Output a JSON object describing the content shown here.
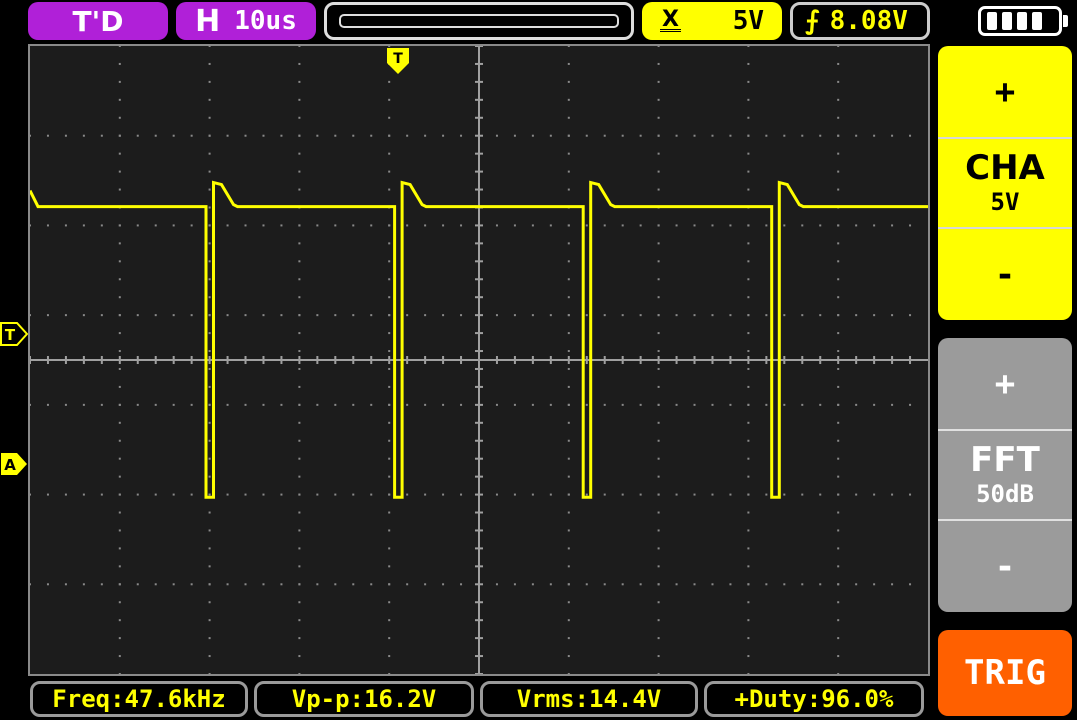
{
  "top_bar": {
    "mode_label": "T'D",
    "timebase_letter": "H",
    "timebase_value": "10us",
    "channel_scale": "5V",
    "channel_icon": "channel-coupling-icon",
    "trigger_level": "8.08V",
    "trigger_icon": "rising-edge-icon",
    "battery_icon": "battery-full-icon"
  },
  "markers": {
    "trigger_time_marker": "T",
    "trigger_level_marker": "T",
    "channel_marker": "A"
  },
  "right_panel": {
    "channel": {
      "plus": "+",
      "name": "CHA",
      "scale": "5V",
      "minus": "-"
    },
    "fft": {
      "plus": "+",
      "name": "FFT",
      "scale": "50dB",
      "minus": "-"
    },
    "trig_button": "TRIG"
  },
  "measurements": {
    "freq": "Freq:47.6kHz",
    "vpp": "Vp-p:16.2V",
    "vrms": "Vrms:14.4V",
    "duty": "+Duty:96.0%"
  },
  "colors": {
    "trace": "#ffff00",
    "mode_accent": "#b020d8",
    "channel_accent": "#ffff00",
    "fft_accent": "#9b9b9b",
    "trig_accent": "#ff6000",
    "plot_background": "#1c1c1c"
  },
  "waveform": {
    "volts_per_division": 5,
    "time_per_division_us": 10,
    "high_level_v": 14.4,
    "low_level_v": -1.8,
    "period_divisions": 2.1,
    "duty_percent": 96.0
  }
}
